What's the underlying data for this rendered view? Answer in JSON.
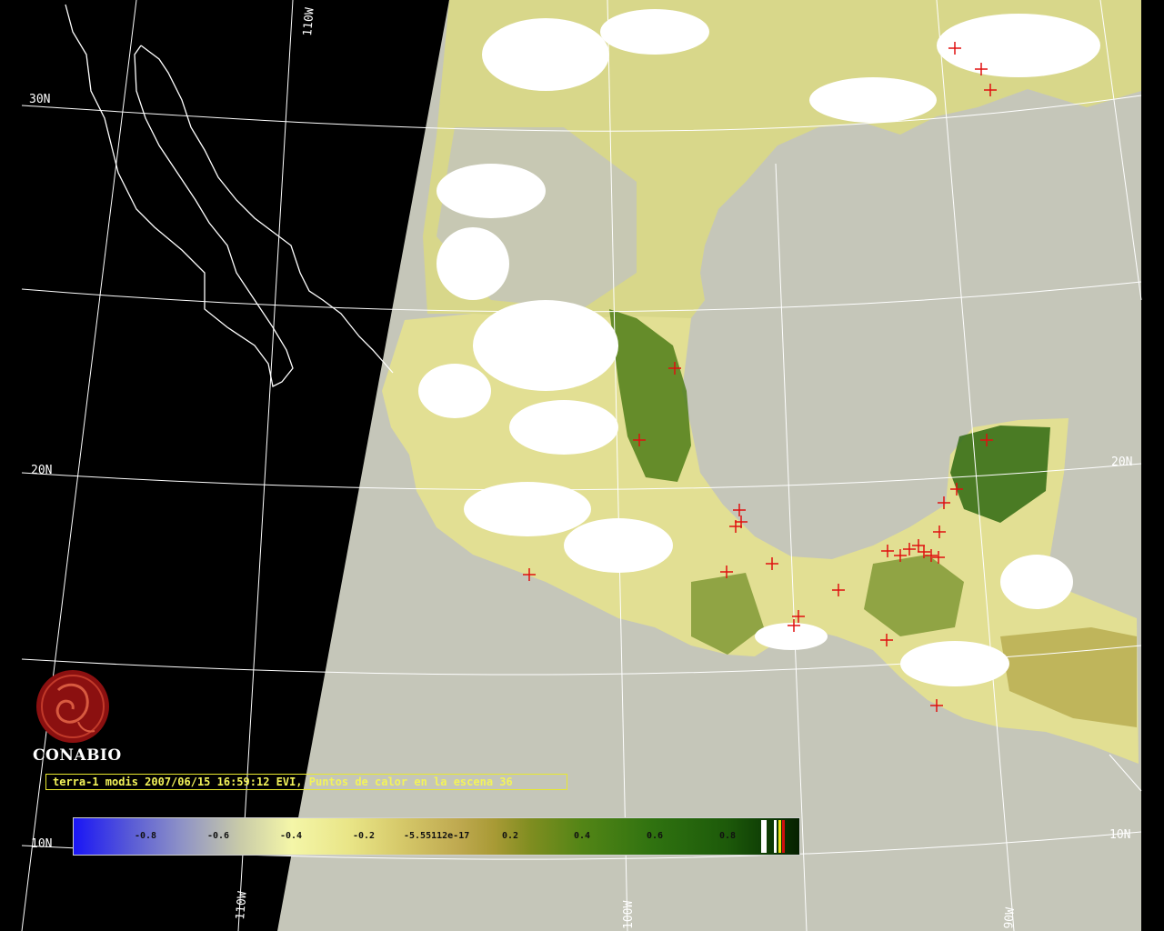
{
  "grid_labels": {
    "lon_110w_top": "110W",
    "lat_30n": "30N",
    "lat_20n_left": "20N",
    "lat_20n_right": "20N",
    "lat_10n_left": "10N",
    "lat_10n_right": "10N",
    "lon_110w_bottom": "110W",
    "lon_100w_bottom": "100W",
    "lon_90w_bottom": "90W"
  },
  "logo": {
    "text": "CONABIO",
    "icon": "conabio-logo-icon"
  },
  "caption": "terra-1 modis 2007/06/15 16:59:12 EVI, Puntos de calor en la escena 36",
  "colorbar": {
    "ticks": [
      "-0.8",
      "-0.6",
      "-0.4",
      "-0.2",
      "-5.55112e-17",
      "0.2",
      "0.4",
      "0.6",
      "0.8"
    ]
  },
  "colors": {
    "ocean": "#c5c6b9",
    "grid": "#ffffff",
    "hotspot": "#e01010",
    "coast": "#ffffff",
    "caption_text": "#f3f35a"
  }
}
